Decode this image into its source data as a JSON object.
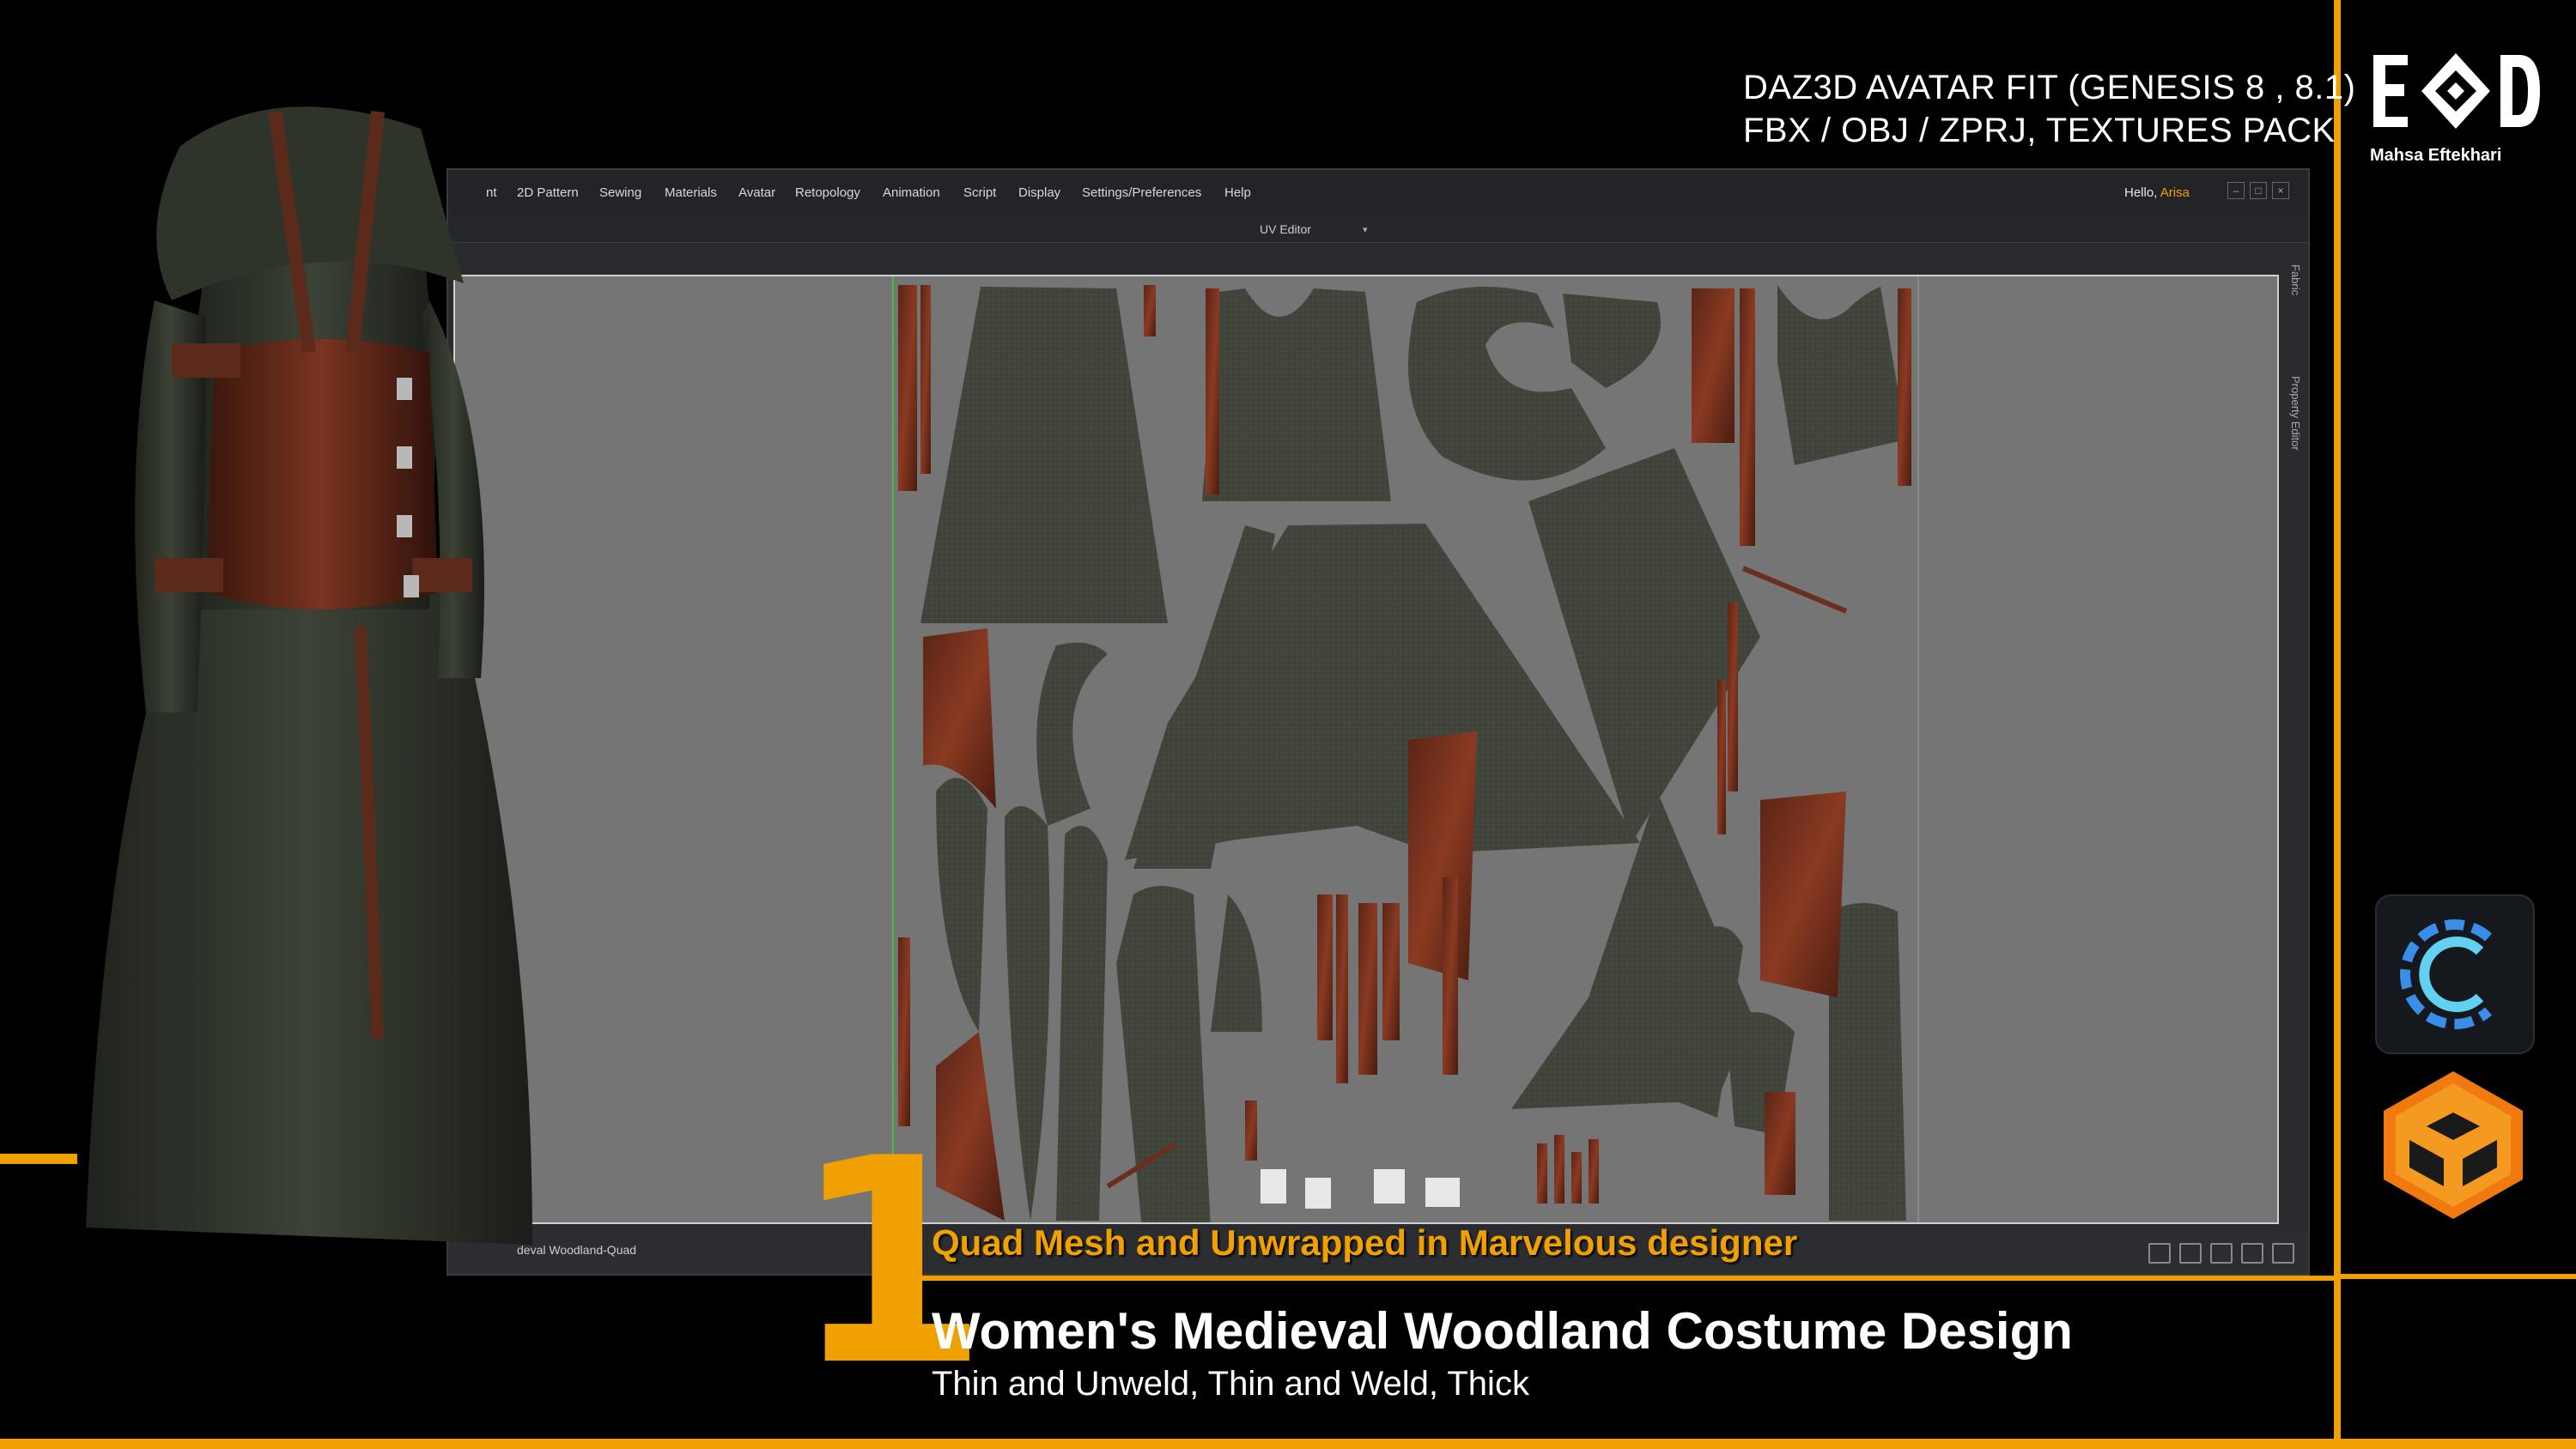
{
  "info": {
    "line1": "DAZ3D AVATAR FIT (GENESIS 8 , 8.1)",
    "line2": "FBX / OBJ / ZPRJ, TEXTURES PACK"
  },
  "brand": {
    "name": "Mahsa Eftekhari",
    "logo_icon": "logo-icon"
  },
  "app": {
    "menu": [
      "nt",
      "2D Pattern",
      "Sewing",
      "Materials",
      "Avatar",
      "Retopology",
      "Animation",
      "Script",
      "Display",
      "Settings/Preferences",
      "Help"
    ],
    "greeting": "Hello,",
    "user": "Arisa",
    "panel_title": "UV Editor",
    "side_tabs": [
      "Fabric",
      "Property Editor"
    ],
    "status_text": "deval Woodland-Quad"
  },
  "overlay": {
    "number": "1",
    "quad_label": "Quad Mesh and Unwrapped in Marvelous designer",
    "title": "Women's Medieval Woodland Costume Design",
    "subtitle": "Thin and Unweld, Thin and Weld, Thick"
  },
  "icons": [
    "clo-icon",
    "marvelous-icon"
  ],
  "colors": {
    "accent": "#f0a000",
    "fabric": "#3d4038",
    "leather": "#6b2e1f"
  }
}
